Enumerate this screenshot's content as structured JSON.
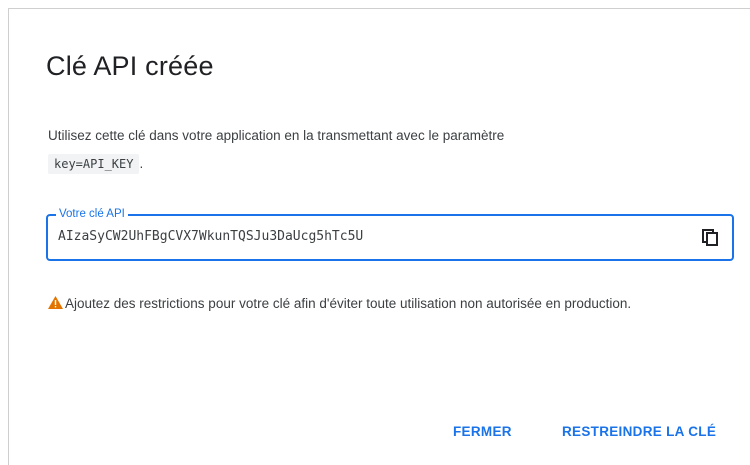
{
  "dialog": {
    "title": "Clé API créée",
    "description_text": "Utilisez cette clé dans votre application en la transmettant avec le paramètre",
    "param_code": "key=API_KEY",
    "param_suffix": ".",
    "key_field": {
      "label": "Votre clé API",
      "value": "AIzaSyCW2UhFBgCVX7WkunTQSJu3DaUcg5hTc5U",
      "copy_icon": "copy-icon"
    },
    "warning": {
      "icon": "warning-icon",
      "icon_color": "#e37400",
      "text": "Ajoutez des restrictions pour votre clé afin d'éviter toute utilisation non autorisée en production."
    },
    "actions": {
      "close_label": "FERMER",
      "restrict_label": "RESTREINDRE LA CLÉ"
    }
  },
  "colors": {
    "accent": "#1a73e8",
    "text": "#3c4043",
    "title": "#202124"
  }
}
